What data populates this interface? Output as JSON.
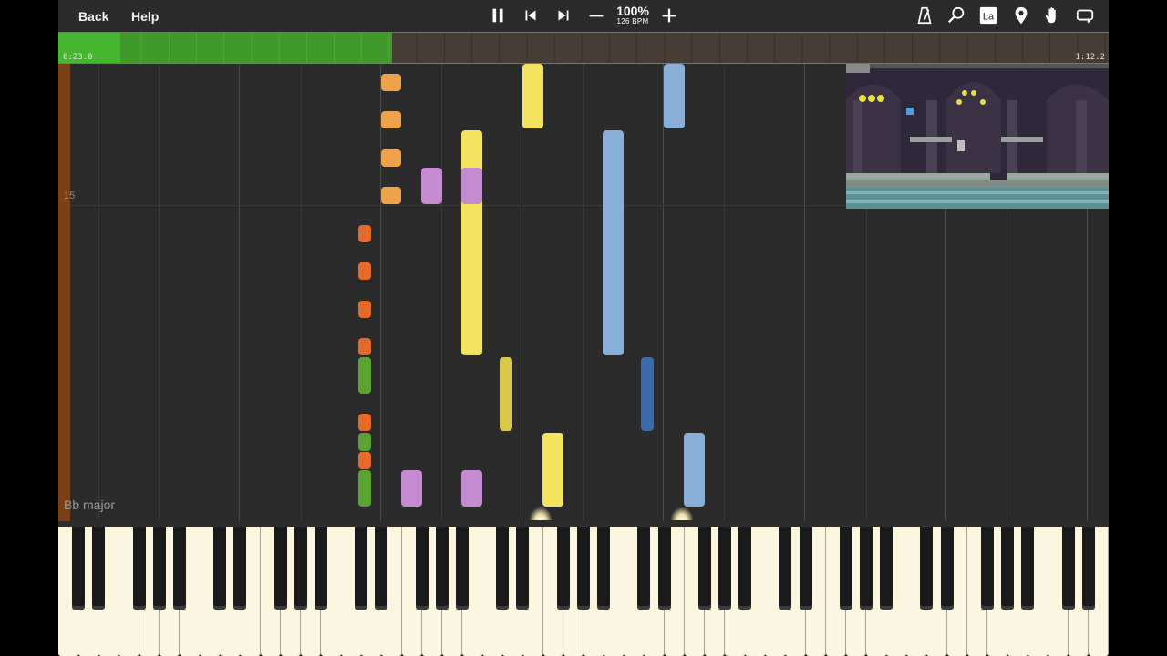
{
  "toolbar": {
    "back_label": "Back",
    "help_label": "Help",
    "tempo_percent": "100%",
    "tempo_bpm": "126 BPM",
    "icons": [
      "pause-icon",
      "skip-back-icon",
      "skip-forward-icon",
      "minus-icon",
      "plus-icon",
      "metronome-icon",
      "search-icon",
      "note-label-icon",
      "marker-icon",
      "hand-icon",
      "loop-icon"
    ],
    "note_label_text": "La"
  },
  "progress": {
    "current_time": "0:23.0",
    "total_time": "1:12.2",
    "position_fraction": 0.318
  },
  "roll": {
    "measure_number": "15",
    "key_signature": "Bb major"
  },
  "colors": {
    "orange": "#f0a24a",
    "dark_orange": "#e46a2a",
    "green": "#5aa332",
    "purple": "#c48bd1",
    "yellow": "#f3e35f",
    "dark_yellow": "#d8c84c",
    "light_blue": "#89aed8",
    "dark_blue": "#3c6aa6"
  }
}
